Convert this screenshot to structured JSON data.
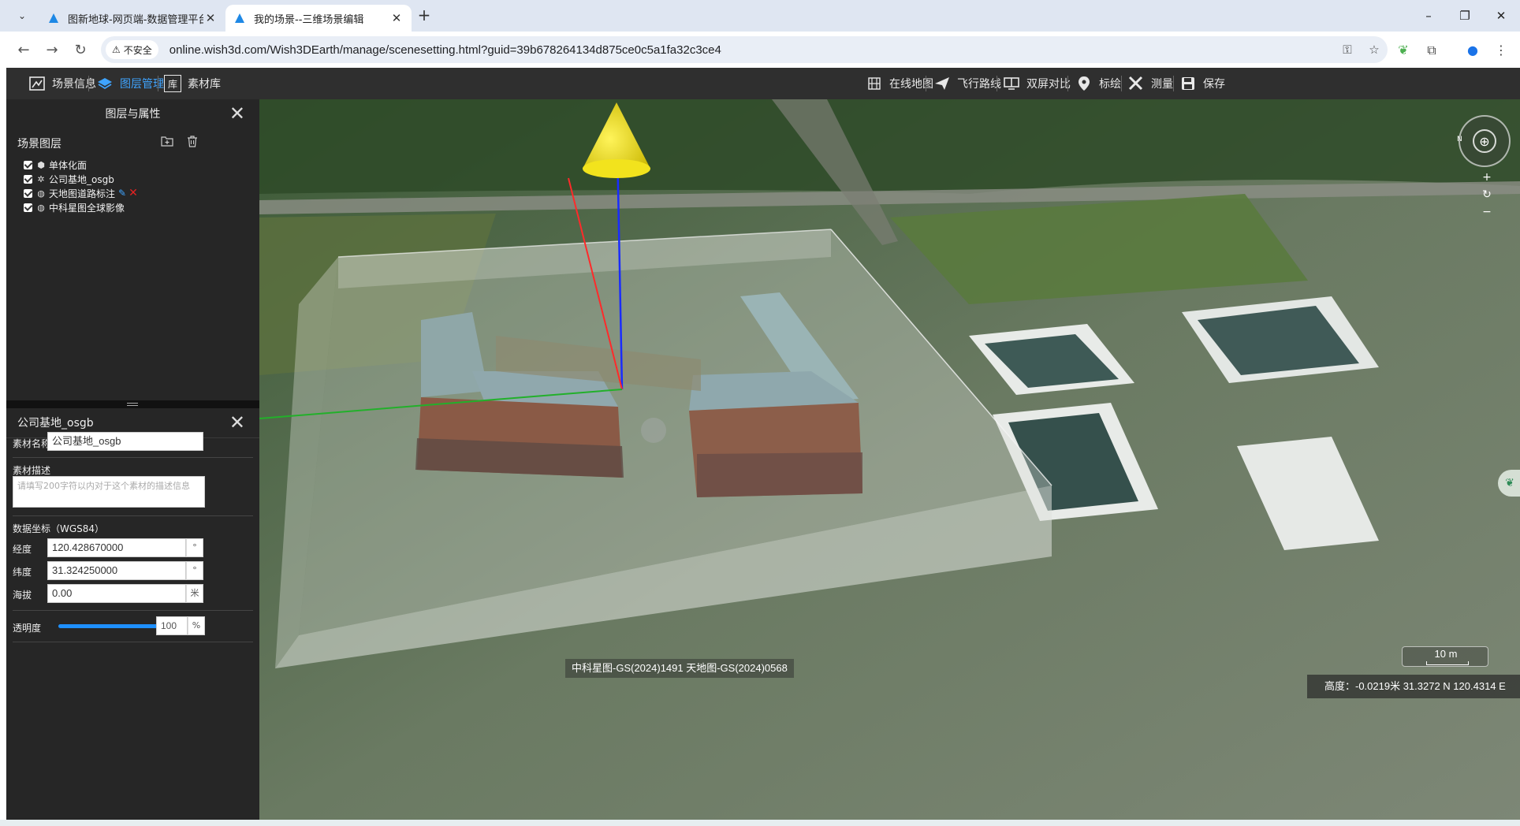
{
  "browser": {
    "tabs": [
      {
        "title": "图新地球-网页端-数据管理平台",
        "active": false
      },
      {
        "title": "我的场景--三维场景编辑",
        "active": true
      }
    ],
    "security_label": "不安全",
    "url": "online.wish3d.com/Wish3DEarth/manage/scenesetting.html?guid=39b678264134d875ce0c5a1fa32c3ce4"
  },
  "header": {
    "left_items": [
      {
        "label": "场景信息",
        "icon": "scene-info-icon",
        "active": false
      },
      {
        "label": "图层管理",
        "icon": "layers-icon",
        "active": true
      },
      {
        "label": "素材库",
        "icon": "library-icon",
        "active": false
      }
    ],
    "right_items": [
      {
        "label": "在线地图",
        "icon": "online-map-icon"
      },
      {
        "label": "飞行路线",
        "icon": "flight-route-icon"
      },
      {
        "label": "双屏对比",
        "icon": "dual-screen-icon"
      },
      {
        "label": "标绘",
        "icon": "marker-icon"
      },
      {
        "label": "测量",
        "icon": "measure-icon"
      },
      {
        "label": "保存",
        "icon": "save-icon"
      }
    ],
    "library_glyph": "库"
  },
  "layer_panel": {
    "title": "图层与属性",
    "section_title": "场景图层",
    "layers": [
      {
        "label": "单体化面",
        "icon": "cube-icon",
        "checked": true
      },
      {
        "label": "公司基地_osgb",
        "icon": "model-icon",
        "checked": true
      },
      {
        "label": "天地图道路标注",
        "icon": "globe-icon",
        "checked": true,
        "editable": true
      },
      {
        "label": "中科星图全球影像",
        "icon": "globe-icon",
        "checked": true
      }
    ]
  },
  "properties": {
    "title": "公司基地_osgb",
    "name_label": "素材名称",
    "name_value": "公司基地_osgb",
    "desc_label": "素材描述",
    "desc_placeholder": "请填写200字符以内对于这个素材的描述信息",
    "coord_label": "数据坐标（WGS84）",
    "lon_label": "经度",
    "lon_value": "120.428670000",
    "lon_unit": "°",
    "lat_label": "纬度",
    "lat_value": "31.324250000",
    "lat_unit": "°",
    "alt_label": "海拔",
    "alt_value": "0.00",
    "alt_unit": "米",
    "opacity_label": "透明度",
    "opacity_value": "100",
    "opacity_unit": "%",
    "opacity_fraction": 1.0
  },
  "scene": {
    "compass_label": "N",
    "attribution": "中科星图-GS(2024)1491 天地图-GS(2024)0568",
    "scale_label": "10 m",
    "status": "高度：-0.0219米 31.3272 N 120.4314 E"
  },
  "colors": {
    "accent": "#3fa4ff",
    "header_bg": "#2f2f2f",
    "panel_bg": "#262626",
    "delete": "#e42222"
  }
}
